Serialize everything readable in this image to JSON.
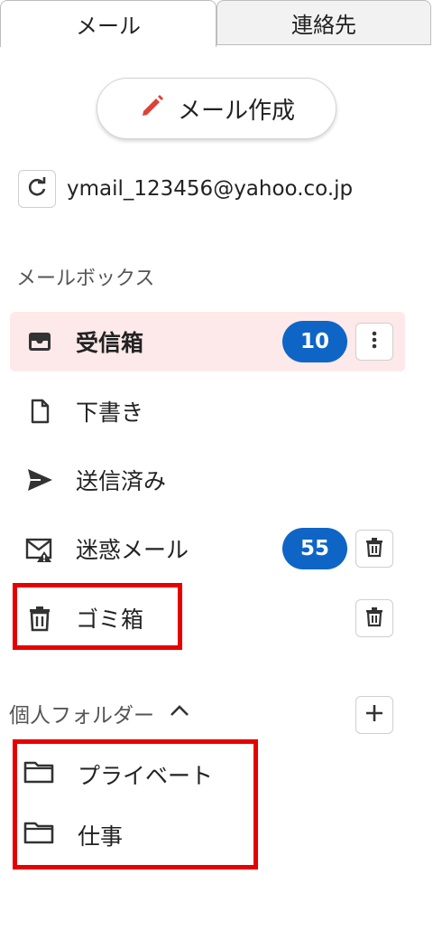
{
  "tabs": [
    {
      "label": "メール",
      "active": true
    },
    {
      "label": "連絡先",
      "active": false
    }
  ],
  "compose": {
    "label": "メール作成",
    "icon": "pencil-icon",
    "icon_color": "#e0403a"
  },
  "account": {
    "email": "ymail_123456@yahoo.co.jp",
    "refresh_icon": "refresh-icon"
  },
  "mailbox_section": {
    "label": "メールボックス"
  },
  "mailboxes": [
    {
      "label": "受信箱",
      "icon": "inbox-icon",
      "badge": "10",
      "action": "more-vertical-icon",
      "active": true
    },
    {
      "label": "下書き",
      "icon": "document-icon",
      "badge": null,
      "action": null,
      "active": false
    },
    {
      "label": "送信済み",
      "icon": "send-icon",
      "badge": null,
      "action": null,
      "active": false
    },
    {
      "label": "迷惑メール",
      "icon": "spam-mail-icon",
      "badge": "55",
      "action": "trash-icon",
      "active": false
    },
    {
      "label": "ゴミ箱",
      "icon": "trash-icon",
      "badge": null,
      "action": "trash-icon",
      "active": false
    }
  ],
  "personal_folders": {
    "label": "個人フォルダー",
    "toggle_icon": "chevron-up-icon",
    "add_icon": "plus-icon",
    "items": [
      {
        "label": "プライベート",
        "icon": "folder-icon"
      },
      {
        "label": "仕事",
        "icon": "folder-icon"
      }
    ]
  },
  "colors": {
    "badge": "#0e65c6",
    "active_row": "#fde9e9",
    "highlight_box": "#e60000"
  }
}
